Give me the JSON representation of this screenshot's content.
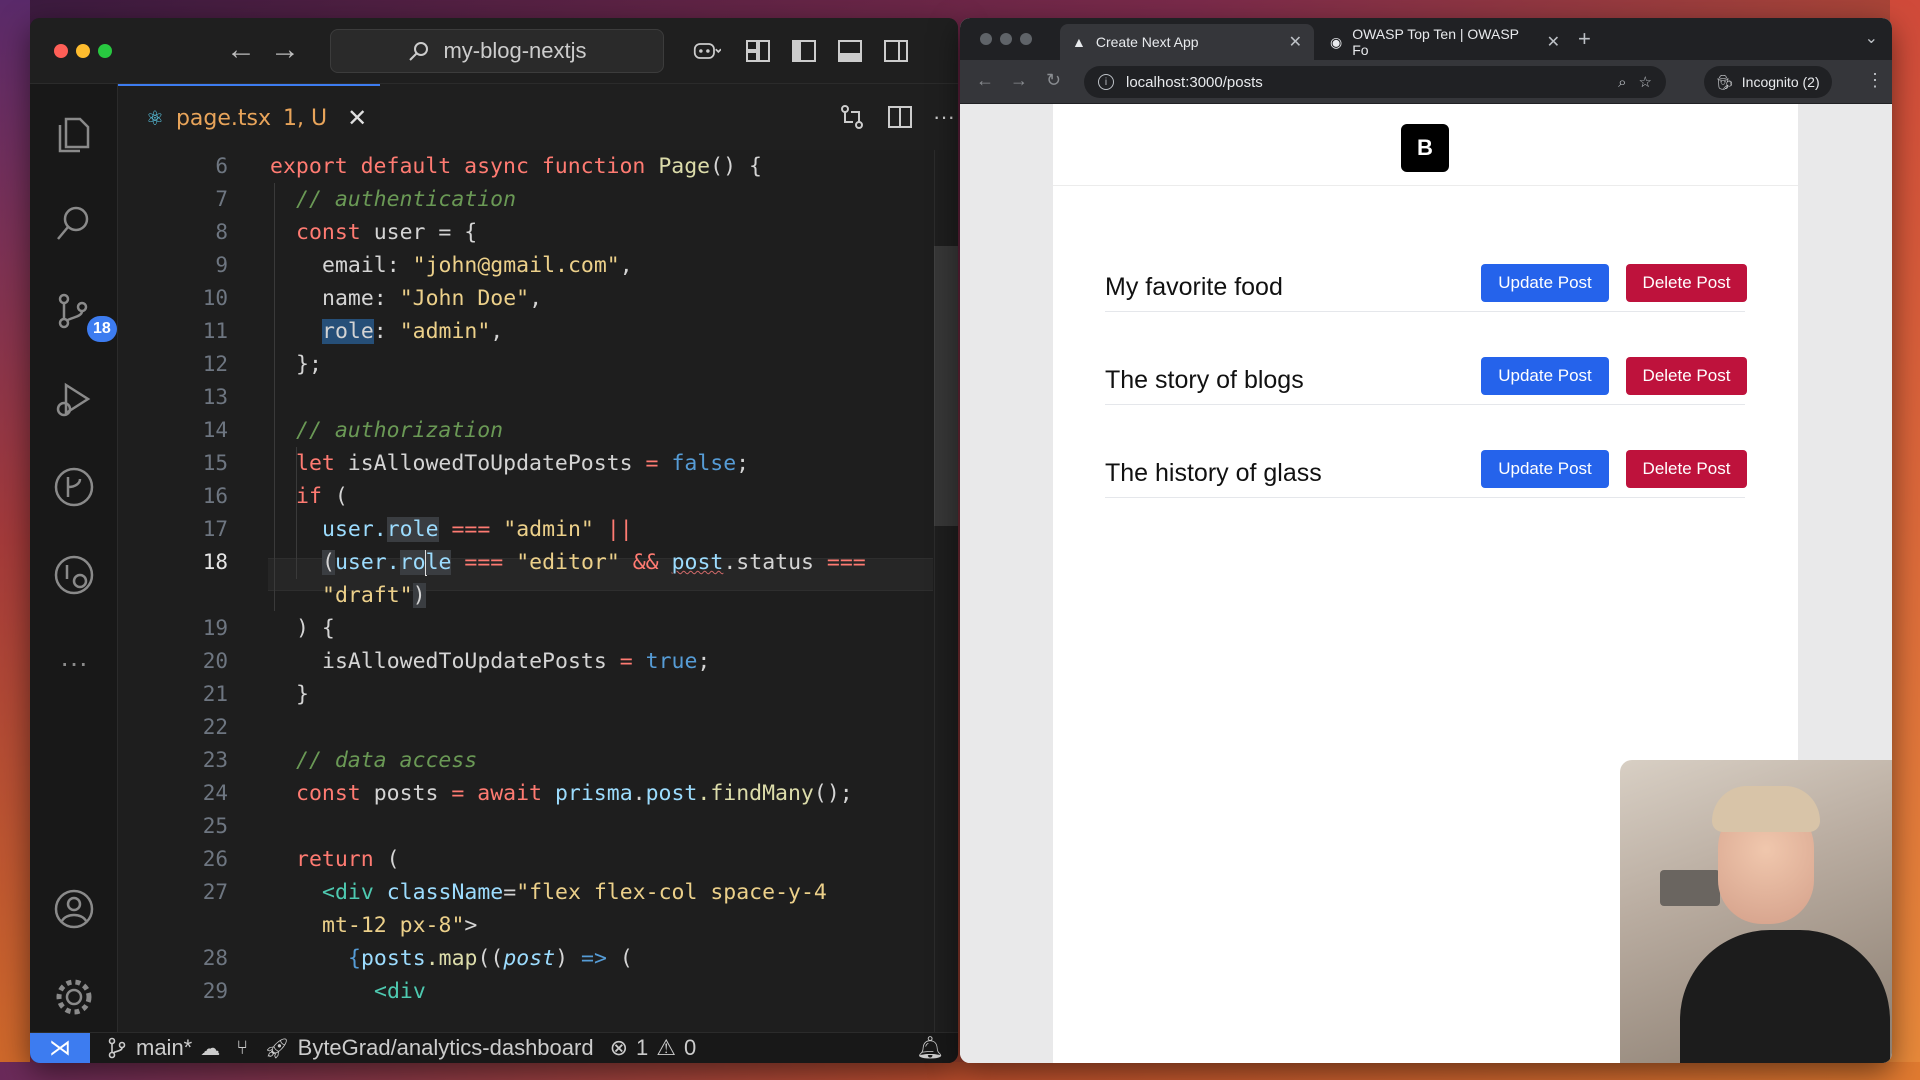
{
  "vscode": {
    "search_text": "my-blog-nextjs",
    "tab": {
      "filename": "page.tsx",
      "status": "1, U"
    },
    "activity_badge": "18",
    "line_numbers": [
      "6",
      "7",
      "8",
      "9",
      "10",
      "11",
      "12",
      "13",
      "14",
      "15",
      "16",
      "17",
      "18",
      "",
      "19",
      "20",
      "21",
      "22",
      "23",
      "24",
      "25",
      "26",
      "27",
      "",
      "28",
      "29"
    ],
    "active_line": "18",
    "statusbar": {
      "branch": "main*",
      "repo": "ByteGrad/analytics-dashboard",
      "errors": "1",
      "warnings": "0"
    }
  },
  "code": {
    "l6": {
      "kw": "export default async function",
      "fn": "Page",
      "rest": "() {"
    },
    "l7": "// authentication",
    "l8": {
      "kw": "const",
      "name": "user",
      "rest": "= {"
    },
    "l9": {
      "key": "email:",
      "val": "\"john@gmail.com\"",
      "tail": ","
    },
    "l10": {
      "key": "name:",
      "val": "\"John Doe\"",
      "tail": ","
    },
    "l11": {
      "key": "role",
      "colon": ":",
      "val": "\"admin\"",
      "tail": ","
    },
    "l12": "};",
    "l14": "// authorization",
    "l15": {
      "kw": "let",
      "name": "isAllowedToUpdatePosts",
      "eq": "=",
      "val": "false",
      "tail": ";"
    },
    "l16": {
      "kw": "if",
      "rest": "("
    },
    "l17": {
      "obj": "user.",
      "prop": "role",
      "op": "===",
      "val": "\"admin\"",
      "or": "||"
    },
    "l18": {
      "paren": "(",
      "obj": "user.",
      "prop_a": "ro",
      "prop_b": "le",
      "op": "===",
      "val": "\"editor\"",
      "and": "&&",
      "post": "post",
      "dot": ".status",
      "op2": "==="
    },
    "l18b": {
      "val": "\"draft\"",
      "paren": ")"
    },
    "l19": ") {",
    "l20": {
      "name": "isAllowedToUpdatePosts",
      "eq": "=",
      "val": "true",
      "tail": ";"
    },
    "l21": "}",
    "l23": "// data access",
    "l24": {
      "kw": "const",
      "name": "posts",
      "eq": "=",
      "await": "await",
      "obj": "prisma",
      "dot": ".",
      "post": "post",
      "call": ".findMany",
      "tail": "();"
    },
    "l26": {
      "kw": "return",
      "rest": "("
    },
    "l27": {
      "tag": "<div",
      "attr": "className",
      "eq": "=",
      "val": "\"flex flex-col space-y-4"
    },
    "l27b": {
      "val": "mt-12 px-8\"",
      "close": ">"
    },
    "l28": {
      "open": "{",
      "obj": "posts",
      "call": ".map",
      "p1": "((",
      "param": "post",
      "p2": ")",
      "arrow": "=>",
      "p3": "("
    },
    "l29": "<div"
  },
  "browser": {
    "tabs": [
      {
        "title": "Create Next App",
        "active": true
      },
      {
        "title": "OWASP Top Ten | OWASP Fo",
        "active": false
      }
    ],
    "url": "localhost:3000/posts",
    "incognito": "Incognito (2)",
    "page": {
      "logo": "B",
      "posts": [
        {
          "title": "My favorite food",
          "update": "Update Post",
          "delete": "Delete Post"
        },
        {
          "title": "The story of blogs",
          "update": "Update Post",
          "delete": "Delete Post"
        },
        {
          "title": "The history of glass",
          "update": "Update Post",
          "delete": "Delete Post"
        }
      ]
    }
  },
  "colors": {
    "accent": "#3d7cf0",
    "update_button": "#2563eb",
    "delete_button": "#be123c"
  }
}
